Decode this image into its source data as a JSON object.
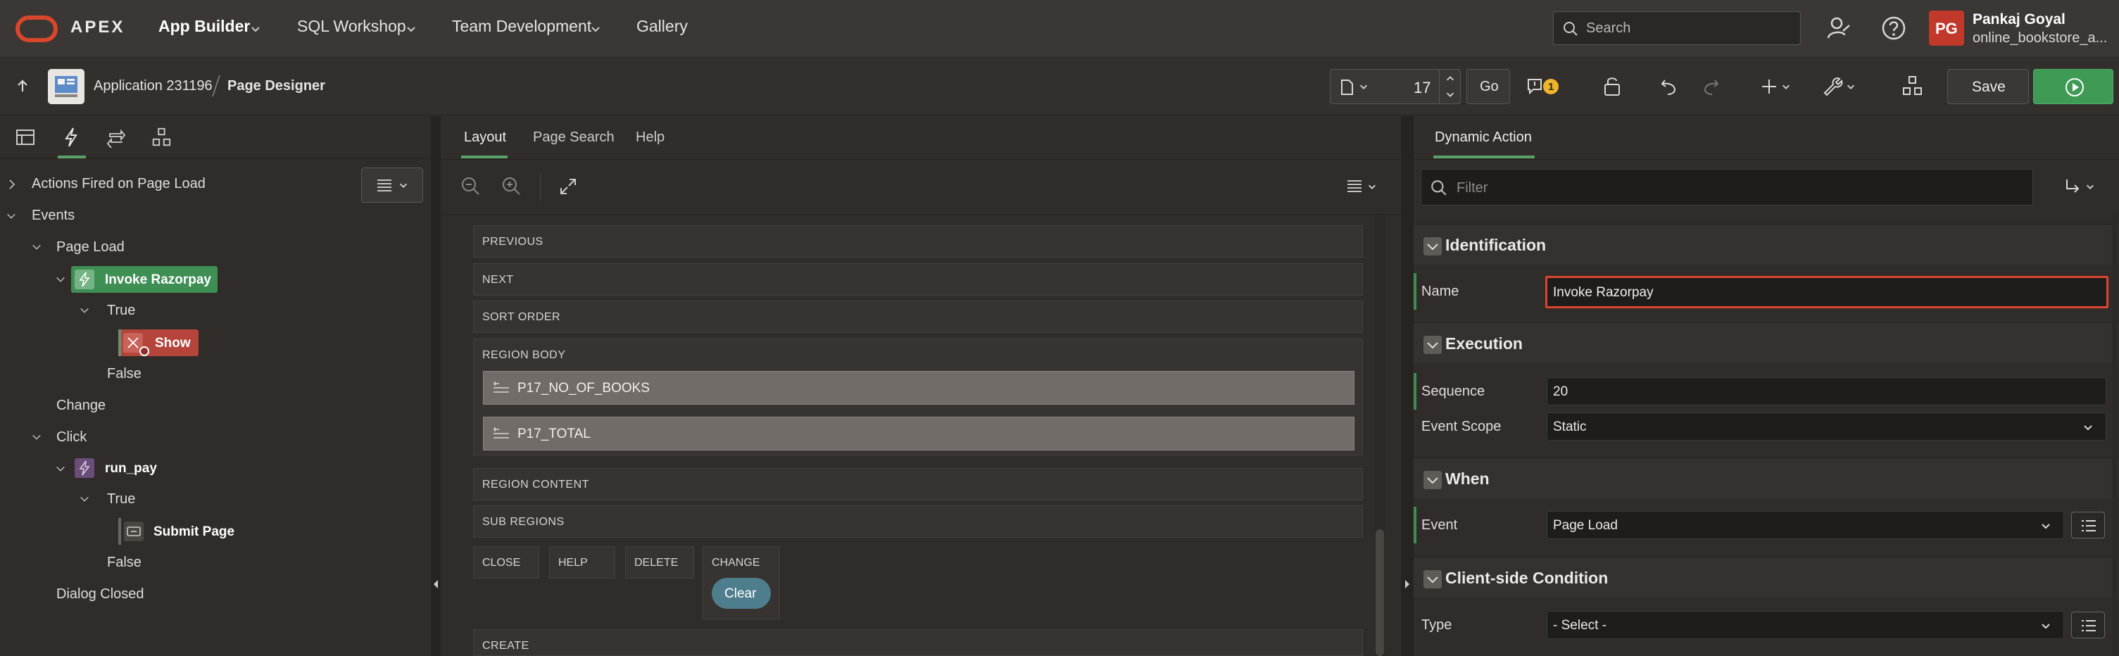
{
  "top": {
    "logo_text": "APEX",
    "nav": [
      "App Builder",
      "SQL Workshop",
      "Team Development",
      "Gallery"
    ],
    "search_placeholder": "Search",
    "user_initials": "PG",
    "user_name": "Pankaj Goyal",
    "workspace": "online_bookstore_a..."
  },
  "toolbar": {
    "application": "Application 231196",
    "page_designer": "Page Designer",
    "page_number": "17",
    "go_label": "Go",
    "warning_count": "1",
    "save_label": "Save"
  },
  "left": {
    "tree": {
      "actions_fired": "Actions Fired on Page Load",
      "events": "Events",
      "page_load": "Page Load",
      "invoke_razorpay": "Invoke Razorpay",
      "true1": "True",
      "show": "Show",
      "false1": "False",
      "change": "Change",
      "click": "Click",
      "run_pay": "run_pay",
      "true2": "True",
      "submit_page": "Submit Page",
      "false2": "False",
      "dialog_closed": "Dialog Closed"
    }
  },
  "middle": {
    "tabs": [
      "Layout",
      "Page Search",
      "Help"
    ],
    "regions": {
      "previous": "PREVIOUS",
      "next": "NEXT",
      "sort_order": "SORT ORDER",
      "region_body": "REGION BODY",
      "item1": "P17_NO_OF_BOOKS",
      "item2": "P17_TOTAL",
      "region_content": "REGION CONTENT",
      "sub_regions": "SUB REGIONS",
      "close": "CLOSE",
      "help": "HELP",
      "delete": "DELETE",
      "change": "CHANGE",
      "clear_button": "Clear",
      "create": "CREATE"
    }
  },
  "right": {
    "tab": "Dynamic Action",
    "filter_placeholder": "Filter",
    "sections": {
      "identification": "Identification",
      "execution": "Execution",
      "when": "When",
      "client_condition": "Client-side Condition"
    },
    "props": {
      "name_label": "Name",
      "name_value": "Invoke Razorpay",
      "sequence_label": "Sequence",
      "sequence_value": "20",
      "scope_label": "Event Scope",
      "scope_value": "Static",
      "event_label": "Event",
      "event_value": "Page Load",
      "type_label": "Type",
      "type_value": "- Select -"
    }
  },
  "colors": {
    "accent_green": "#3f9a56",
    "action_red": "#b5443a",
    "highlight_border": "#d9462c",
    "tab_underline": "#5aa06a"
  }
}
